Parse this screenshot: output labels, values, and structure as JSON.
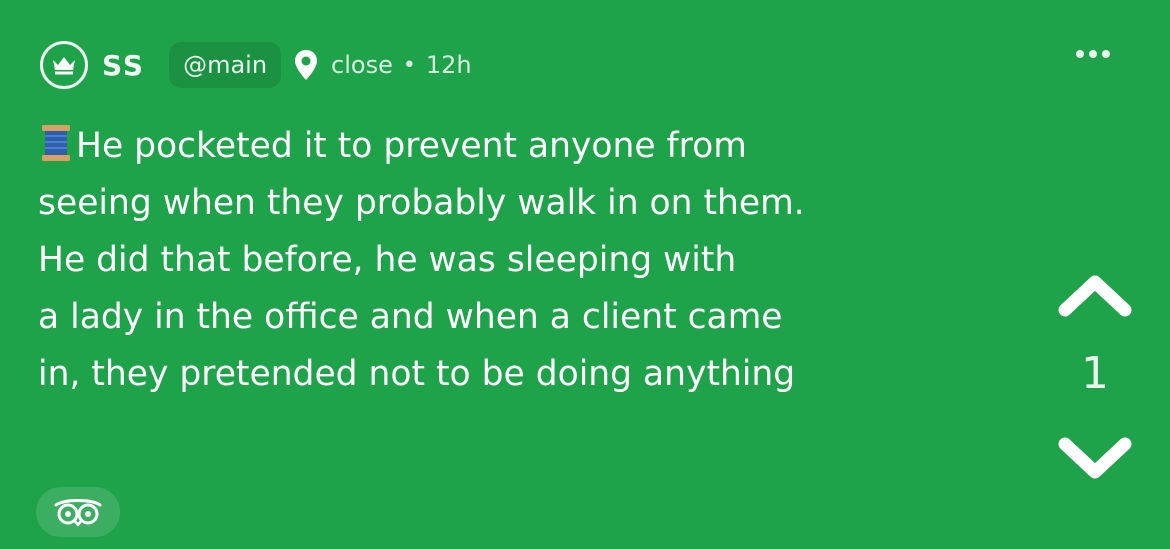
{
  "post": {
    "author": "SS",
    "channel": "@main",
    "location": "close",
    "separator": "•",
    "age": "12h",
    "emoji_icon": "spool-of-thread-icon",
    "text": "He pocketed it to prevent anyone from\nseeing when they probably walk in on them.\nHe did that before, he was sleeping with\na lady in the office and when a client came\nin, they pretended not to be doing anything",
    "vote_count": "1"
  },
  "icons": {
    "avatar": "crown-icon",
    "location": "map-pin-icon",
    "more": "more-options-icon",
    "upvote": "chevron-up-icon",
    "downvote": "chevron-down-icon",
    "bottom_action": "owl-eyes-icon"
  },
  "colors": {
    "background": "#1fa34a",
    "text": "#ffffff"
  }
}
